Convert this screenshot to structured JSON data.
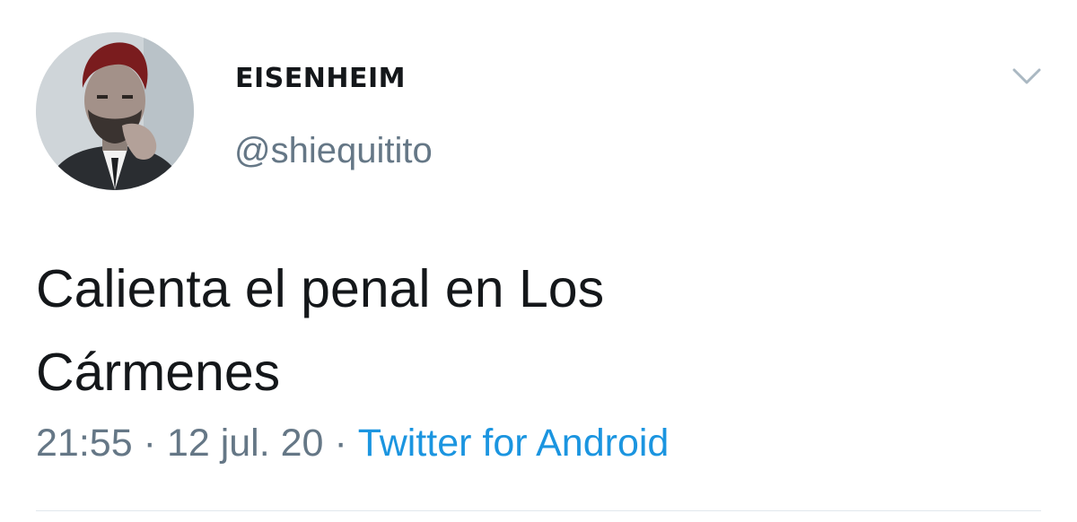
{
  "tweet": {
    "author": {
      "display_name": "EISENHEIM",
      "handle": "@shiequitito"
    },
    "text_line1": "Calienta el penal en Los",
    "text_line2": "Cármenes",
    "time": "21:55",
    "date": "12 jul. 20",
    "separator": "·",
    "source": "Twitter for Android"
  },
  "icons": {
    "avatar": "avatar-photo",
    "menu": "chevron-down-icon"
  },
  "colors": {
    "text_primary": "#14171a",
    "text_secondary": "#657786",
    "link": "#1b95e0",
    "divider": "#e1e8ed"
  }
}
